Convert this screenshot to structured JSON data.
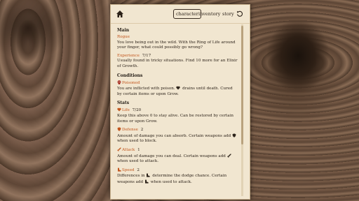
{
  "nav": {
    "tabs": [
      {
        "label": "character",
        "active": true
      },
      {
        "label": "inventory",
        "active": false
      },
      {
        "label": "story",
        "active": false
      }
    ]
  },
  "main": {
    "heading": "Main",
    "rogue_title": "Rogue",
    "rogue_desc": "You love being out in the wild. With the Ring of Life around your finger, what could possibly go wrong?",
    "experience_title": "Experience",
    "experience_value": "7/17",
    "experience_desc": "Usually found in tricky situations. Find 10 more for an Elixir of Growth."
  },
  "conditions": {
    "heading": "Conditions",
    "poisoned_title": "Poisoned",
    "poisoned_desc_a": "You are inflicted with poison.",
    "poisoned_desc_b": "drains until death. Cured by certain items or upon Grow."
  },
  "stats": {
    "heading": "Stats",
    "life_title": "Life",
    "life_value": "7/20",
    "life_desc": "Keep this above 0 to stay alive. Can be restored by certain items or upon Grow.",
    "defense_title": "Defense",
    "defense_value": "2",
    "defense_desc_a": "Amount of damage you can absorb. Certain weapons add",
    "defense_desc_b": "when used to block.",
    "attack_title": "Attack",
    "attack_value": "1",
    "attack_desc_a": "Amount of damage you can deal. Certain weapons add",
    "attack_desc_b": "when used to attack.",
    "speed_title": "Speed",
    "speed_value": "2",
    "speed_desc_a": "Differences in",
    "speed_desc_b": "determine the dodge chance. Certain weapons add",
    "speed_desc_c": "when used to attack."
  },
  "colors": {
    "accent": "#c2571f",
    "panel": "#f1e6d0",
    "text": "#2e241b"
  }
}
